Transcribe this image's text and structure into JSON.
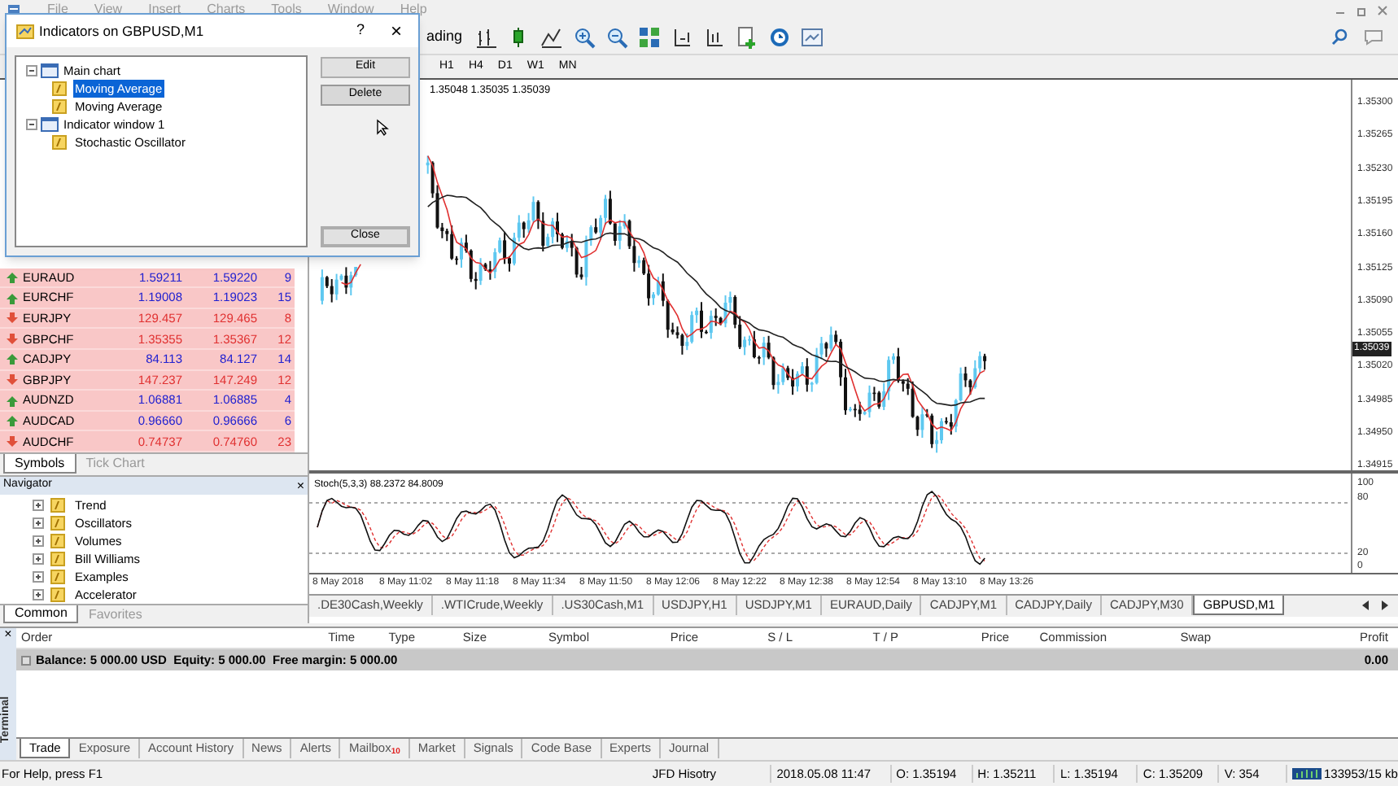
{
  "menu": [
    "File",
    "View",
    "Insert",
    "Charts",
    "Tools",
    "Window",
    "Help"
  ],
  "toolbar": {
    "autotrading_label": "ading"
  },
  "timeframes": [
    "H1",
    "H4",
    "D1",
    "W1",
    "MN"
  ],
  "dialog": {
    "title": "Indicators on GBPUSD,M1",
    "help": "?",
    "close_glyph": "×",
    "tree": [
      {
        "label": "Main chart",
        "kind": "window",
        "expanded": true,
        "children": [
          {
            "label": "Moving Average",
            "kind": "indicator",
            "selected": true
          },
          {
            "label": "Moving Average",
            "kind": "indicator",
            "selected": false
          }
        ]
      },
      {
        "label": "Indicator window 1",
        "kind": "window",
        "expanded": true,
        "children": [
          {
            "label": "Stochastic Oscillator",
            "kind": "indicator",
            "selected": false
          }
        ]
      }
    ],
    "buttons": [
      {
        "label": "Edit",
        "hovered": false,
        "default": false
      },
      {
        "label": "Delete",
        "hovered": true,
        "default": false
      },
      {
        "label": "Close",
        "hovered": false,
        "default": true
      }
    ]
  },
  "market_watch": {
    "rows": [
      {
        "symbol": "EURAUD",
        "rising": true,
        "bid": "1.59211",
        "ask": "1.59220",
        "spread": "9"
      },
      {
        "symbol": "EURCHF",
        "rising": true,
        "bid": "1.19008",
        "ask": "1.19023",
        "spread": "15"
      },
      {
        "symbol": "EURJPY",
        "rising": false,
        "bid": "129.457",
        "ask": "129.465",
        "spread": "8"
      },
      {
        "symbol": "GBPCHF",
        "rising": false,
        "bid": "1.35355",
        "ask": "1.35367",
        "spread": "12"
      },
      {
        "symbol": "CADJPY",
        "rising": true,
        "bid": "84.113",
        "ask": "84.127",
        "spread": "14"
      },
      {
        "symbol": "GBPJPY",
        "rising": false,
        "bid": "147.237",
        "ask": "147.249",
        "spread": "12"
      },
      {
        "symbol": "AUDNZD",
        "rising": true,
        "bid": "1.06881",
        "ask": "1.06885",
        "spread": "4"
      },
      {
        "symbol": "AUDCAD",
        "rising": true,
        "bid": "0.96660",
        "ask": "0.96666",
        "spread": "6"
      },
      {
        "symbol": "AUDCHF",
        "rising": false,
        "bid": "0.74737",
        "ask": "0.74760",
        "spread": "23"
      }
    ],
    "tabs": [
      {
        "label": "Symbols",
        "selected": true
      },
      {
        "label": "Tick Chart",
        "selected": false
      }
    ]
  },
  "navigator": {
    "title": "Navigator",
    "close_glyph": "×",
    "items": [
      {
        "label": "Trend"
      },
      {
        "label": "Oscillators"
      },
      {
        "label": "Volumes"
      },
      {
        "label": "Bill Williams"
      },
      {
        "label": "Examples"
      },
      {
        "label": "Accelerator"
      }
    ],
    "tabs": [
      {
        "label": "Common",
        "selected": true
      },
      {
        "label": "Favorites",
        "selected": false
      }
    ]
  },
  "chart": {
    "ohlc_header": "1.35048 1.35035 1.35039",
    "price_labels": [
      "1.35300",
      "1.35265",
      "1.35230",
      "1.35195",
      "1.35160",
      "1.35125",
      "1.35090",
      "1.35055",
      "1.35020",
      "1.34985",
      "1.34950",
      "1.34915"
    ],
    "current_price": "1.35039",
    "indicator_label": "Stoch(5,3,3) 88.2372 84.8009",
    "indicator_levels": [
      "100",
      "80",
      "20",
      "0"
    ],
    "time_labels": [
      "8 May 2018",
      "8 May 11:02",
      "8 May 11:18",
      "8 May 11:34",
      "8 May 11:50",
      "8 May 12:06",
      "8 May 12:22",
      "8 May 12:38",
      "8 May 12:54",
      "8 May 13:10",
      "8 May 13:26"
    ]
  },
  "chart_tabs": [
    {
      "label": ".DE30Cash,Weekly",
      "selected": false
    },
    {
      "label": ".WTICrude,Weekly",
      "selected": false
    },
    {
      "label": ".US30Cash,M1",
      "selected": false
    },
    {
      "label": "USDJPY,H1",
      "selected": false
    },
    {
      "label": "USDJPY,M1",
      "selected": false
    },
    {
      "label": "EURAUD,Daily",
      "selected": false
    },
    {
      "label": "CADJPY,M1",
      "selected": false
    },
    {
      "label": "CADJPY,Daily",
      "selected": false
    },
    {
      "label": "CADJPY,M30",
      "selected": false
    },
    {
      "label": "GBPUSD,M1",
      "selected": true
    }
  ],
  "terminal": {
    "side_label": "Terminal",
    "close_glyph": "×",
    "columns": [
      "Order",
      "Time",
      "Type",
      "Size",
      "Symbol",
      "Price",
      "S / L",
      "T / P",
      "Price",
      "Commission",
      "Swap",
      "Profit"
    ],
    "balance": "Balance: 5 000.00 USD  Equity: 5 000.00  Free margin: 5 000.00",
    "profit": "0.00",
    "tabs": [
      {
        "label": "Trade",
        "selected": true
      },
      {
        "label": "Exposure",
        "selected": false
      },
      {
        "label": "Account History",
        "selected": false
      },
      {
        "label": "News",
        "selected": false
      },
      {
        "label": "Alerts",
        "selected": false
      },
      {
        "label": "Mailbox",
        "selected": false,
        "badge": "10"
      },
      {
        "label": "Market",
        "selected": false
      },
      {
        "label": "Signals",
        "selected": false
      },
      {
        "label": "Code Base",
        "selected": false
      },
      {
        "label": "Experts",
        "selected": false
      },
      {
        "label": "Journal",
        "selected": false
      }
    ]
  },
  "status_bar": [
    "For Help, press F1",
    "JFD Hisotry",
    "2018.05.08 11:47",
    "O: 1.35194",
    "H: 1.35211",
    "L: 1.35194",
    "C: 1.35209",
    "V: 354",
    "133953/15 kb"
  ]
}
